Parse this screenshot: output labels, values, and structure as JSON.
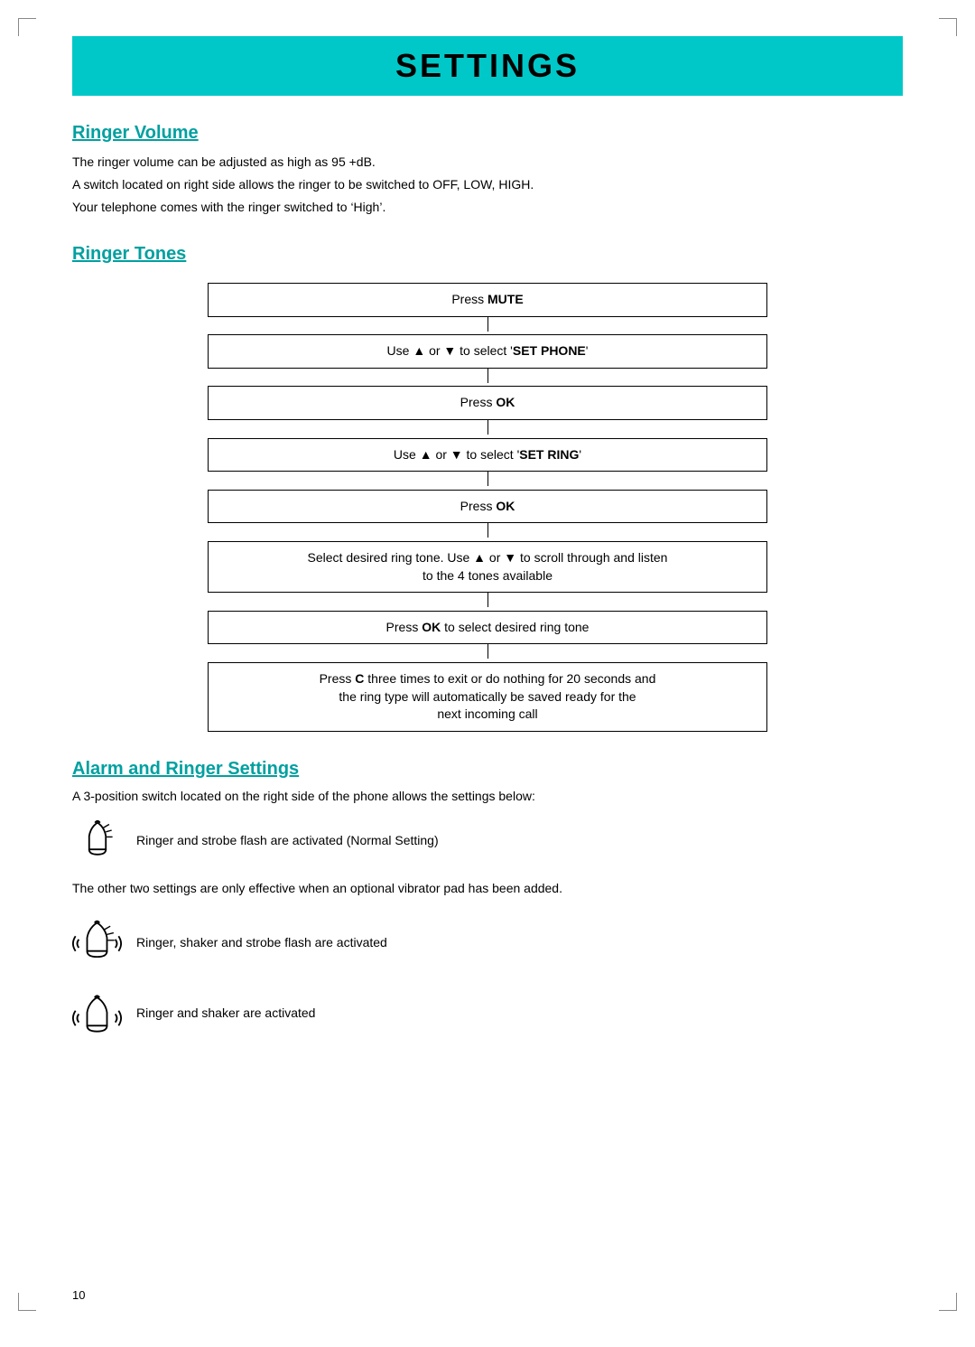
{
  "page": {
    "number": "10",
    "corner_marks": [
      "tl",
      "tr",
      "bl",
      "br"
    ]
  },
  "header": {
    "title": "SETTINGS"
  },
  "ringer_volume": {
    "section_title": "Ringer Volume",
    "lines": [
      "The ringer volume can be adjusted as high as 95 +dB.",
      "A switch located on right side allows the ringer to be switched to OFF, LOW, HIGH.",
      "Your telephone comes with the ringer switched to ‘High’."
    ]
  },
  "ringer_tones": {
    "section_title": "Ringer Tones",
    "flow_steps": [
      {
        "id": "step1",
        "html": "Press <b>MUTE</b>"
      },
      {
        "id": "step2",
        "html": "Use ▲ or ▼ to select ‘<b>SET PHONE</b>’"
      },
      {
        "id": "step3",
        "html": "Press <b>OK</b>"
      },
      {
        "id": "step4",
        "html": "Use ▲ or ▼ to select ‘<b>SET RING</b>’"
      },
      {
        "id": "step5",
        "html": "Press <b>OK</b>"
      },
      {
        "id": "step6",
        "html": "Select desired ring tone.  Use ▲ or ▼ to scroll through and listen<br>to the 4 tones available"
      },
      {
        "id": "step7",
        "html": "Press <b>OK</b> to select desired ring tone"
      },
      {
        "id": "step8",
        "html": "Press <b>C</b> three times to exit or do nothing for 20 seconds and<br>the ring type will automatically be saved ready for the<br>next incoming call"
      }
    ]
  },
  "alarm_ringer": {
    "section_title": "Alarm and Ringer Settings",
    "intro": "A 3-position switch located on the right side of the phone allows the settings below:",
    "settings": [
      {
        "id": "setting1",
        "icon": "bell-simple",
        "text": "Ringer and strobe flash are activated (Normal Setting)"
      },
      {
        "id": "setting2",
        "icon": "bell-vibrate",
        "text": "Ringer, shaker and strobe flash are activated"
      },
      {
        "id": "setting3",
        "icon": "ring-only",
        "text": "Ringer and shaker are activated"
      }
    ],
    "other_settings_note": "The other two settings are only effective when an optional vibrator  pad has been added."
  }
}
